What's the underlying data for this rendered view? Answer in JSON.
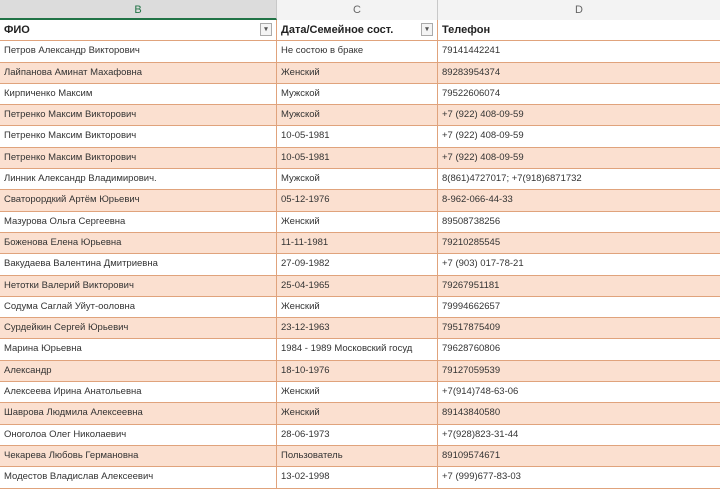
{
  "columns": [
    "B",
    "C",
    "D"
  ],
  "headers": {
    "name": "ФИО",
    "info": "Дата/Семейное сост.",
    "phone": "Телефон"
  },
  "filter_icon": "▾",
  "rows": [
    {
      "name": "Петров Александр Викторович",
      "info": "Не состою в браке",
      "phone": "79141442241"
    },
    {
      "name": "Лайпанова Аминат Махафовна",
      "info": "Женский",
      "phone": "89283954374"
    },
    {
      "name": "Кирпиченко Максим",
      "info": "Мужской",
      "phone": "79522606074"
    },
    {
      "name": "Петренко Максим Викторович",
      "info": "Мужской",
      "phone": "+7 (922) 408-09-59"
    },
    {
      "name": "Петренко Максим Викторович",
      "info": "10-05-1981",
      "phone": "+7 (922) 408-09-59"
    },
    {
      "name": "Петренко Максим Викторович",
      "info": "10-05-1981",
      "phone": "+7 (922) 408-09-59"
    },
    {
      "name": "Линник Александр Владимирович.",
      "info": "Мужской",
      "phone": "8(861)4727017; +7(918)6871732"
    },
    {
      "name": "Сваторордкий Артём Юрьевич",
      "info": "05-12-1976",
      "phone": "8-962-066-44-33"
    },
    {
      "name": "Мазурова Ольга Сергеевна",
      "info": "Женский",
      "phone": "89508738256"
    },
    {
      "name": "Боженова Елена Юрьевна",
      "info": "11-11-1981",
      "phone": "79210285545"
    },
    {
      "name": "Вакудаева Валентина Дмитриевна",
      "info": "27-09-1982",
      "phone": "+7 (903) 017-78-21"
    },
    {
      "name": "Нетотки Валерий Викторович",
      "info": "25-04-1965",
      "phone": "79267951181"
    },
    {
      "name": "Содума Саглай Уйут-ооловна",
      "info": "Женский",
      "phone": "79994662657"
    },
    {
      "name": "Сурдейкин Сергей Юрьевич",
      "info": "23-12-1963",
      "phone": "79517875409"
    },
    {
      "name": "Марина Юрьевна",
      "info": "1984 - 1989 Московский госуд",
      "phone": "79628760806"
    },
    {
      "name": "Александр",
      "info": "18-10-1976",
      "phone": "79127059539"
    },
    {
      "name": "Алексеева Ирина Анатольевна",
      "info": "Женский",
      "phone": "+7(914)748-63-06"
    },
    {
      "name": "Шаврова Людмила Алексеевна",
      "info": "Женский",
      "phone": "89143840580"
    },
    {
      "name": "Оноголоа Олег Николаевич",
      "info": "28-06-1973",
      "phone": "+7(928)823-31-44"
    },
    {
      "name": "Чекарева Любовь Германовна",
      "info": "Пользователь",
      "phone": "89109574671"
    },
    {
      "name": "Модестов Владислав Алексеевич",
      "info": "13-02-1998",
      "phone": "+7 (999)677-83-03"
    }
  ]
}
